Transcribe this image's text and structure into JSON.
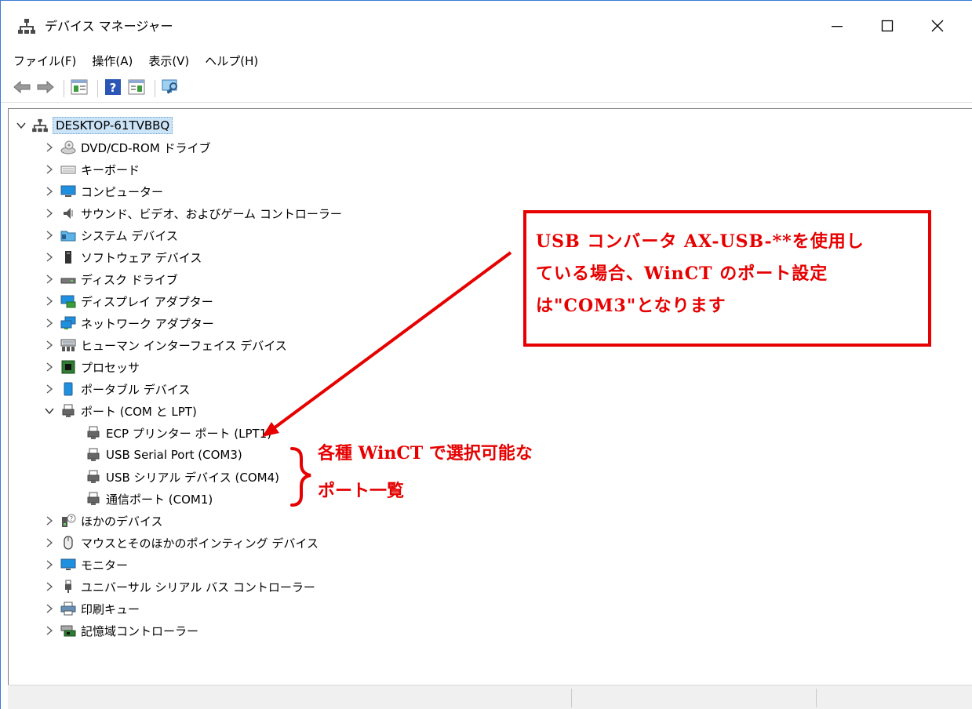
{
  "window": {
    "title": "デバイス マネージャー"
  },
  "menu": [
    "ファイル(F)",
    "操作(A)",
    "表示(V)",
    "ヘルプ(H)"
  ],
  "toolbar_icons": [
    "back-arrow-icon",
    "forward-arrow-icon",
    "properties-icon",
    "help-icon",
    "update-driver-icon",
    "scan-hardware-icon"
  ],
  "tree": {
    "root": "DESKTOP-61TVBBQ",
    "categories": [
      {
        "label": "DVD/CD-ROM ドライブ",
        "icon": "dvd-drive-icon",
        "expanded": false
      },
      {
        "label": "キーボード",
        "icon": "keyboard-icon",
        "expanded": false
      },
      {
        "label": "コンピューター",
        "icon": "computer-icon",
        "expanded": false
      },
      {
        "label": "サウンド、ビデオ、およびゲーム コントローラー",
        "icon": "speaker-icon",
        "expanded": false
      },
      {
        "label": "システム デバイス",
        "icon": "system-device-icon",
        "expanded": false
      },
      {
        "label": "ソフトウェア デバイス",
        "icon": "software-device-icon",
        "expanded": false
      },
      {
        "label": "ディスク ドライブ",
        "icon": "disk-drive-icon",
        "expanded": false
      },
      {
        "label": "ディスプレイ アダプター",
        "icon": "display-adapter-icon",
        "expanded": false
      },
      {
        "label": "ネットワーク アダプター",
        "icon": "network-adapter-icon",
        "expanded": false
      },
      {
        "label": "ヒューマン インターフェイス デバイス",
        "icon": "hid-icon",
        "expanded": false
      },
      {
        "label": "プロセッサ",
        "icon": "processor-icon",
        "expanded": false
      },
      {
        "label": "ポータブル デバイス",
        "icon": "portable-device-icon",
        "expanded": false
      },
      {
        "label": "ポート (COM と LPT)",
        "icon": "port-icon",
        "expanded": true
      },
      {
        "label": "ほかのデバイス",
        "icon": "other-device-icon",
        "expanded": false
      },
      {
        "label": "マウスとそのほかのポインティング デバイス",
        "icon": "mouse-icon",
        "expanded": false
      },
      {
        "label": "モニター",
        "icon": "monitor-icon",
        "expanded": false
      },
      {
        "label": "ユニバーサル シリアル バス コントローラー",
        "icon": "usb-icon",
        "expanded": false
      },
      {
        "label": "印刷キュー",
        "icon": "printer-icon",
        "expanded": false
      },
      {
        "label": "記憶域コントローラー",
        "icon": "storage-controller-icon",
        "expanded": false
      }
    ],
    "ports": [
      "ECP プリンター ポート (LPT1)",
      "USB Serial Port (COM3)",
      "USB シリアル デバイス (COM4)",
      "通信ポート (COM1)"
    ]
  },
  "annotations": {
    "callout_lines": [
      "USB コンバータ AX-USB-**を使用し",
      "ている場合、WinCT のポート設定",
      "は\"COM3\"となります"
    ],
    "brace_note_line1": "各種 WinCT で選択可能な",
    "brace_note_line2": "ポート一覧",
    "accent_color": "#e60000"
  }
}
